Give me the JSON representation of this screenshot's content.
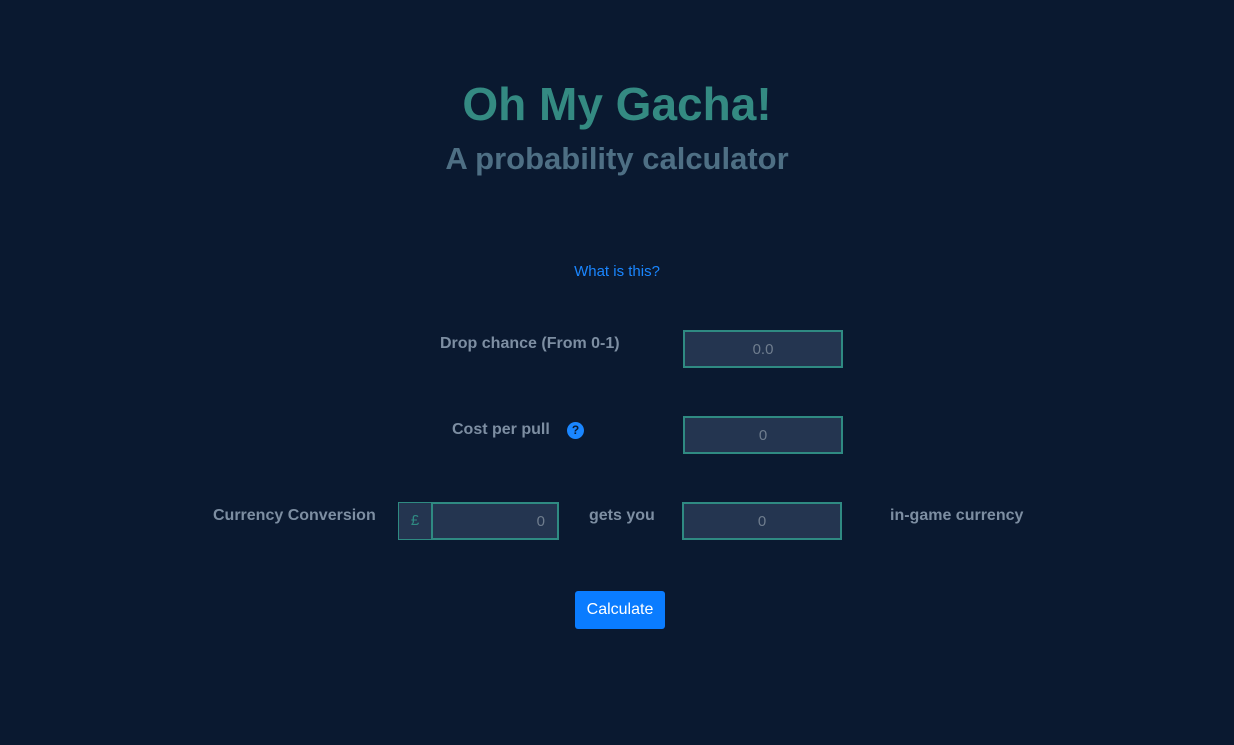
{
  "header": {
    "title": "Oh My Gacha!",
    "subtitle": "A probability calculator"
  },
  "help_link": "What is this?",
  "form": {
    "drop_chance": {
      "label": "Drop chance (From 0-1)",
      "placeholder": "0.0"
    },
    "cost_per_pull": {
      "label": "Cost per pull",
      "help_icon": "question-circle-icon",
      "placeholder": "0"
    },
    "currency_conversion": {
      "label": "Currency Conversion",
      "currency_symbol": "£",
      "money_placeholder": "0",
      "gets_you": "gets you",
      "ingame_placeholder": "0",
      "suffix": "in-game currency"
    }
  },
  "calculate_label": "Calculate",
  "colors": {
    "background": "#0a1930",
    "title": "#348a82",
    "subtitle": "#4e6f84",
    "link": "#1a86ff",
    "field_border": "#2f8a82",
    "button": "#0a7cff"
  }
}
